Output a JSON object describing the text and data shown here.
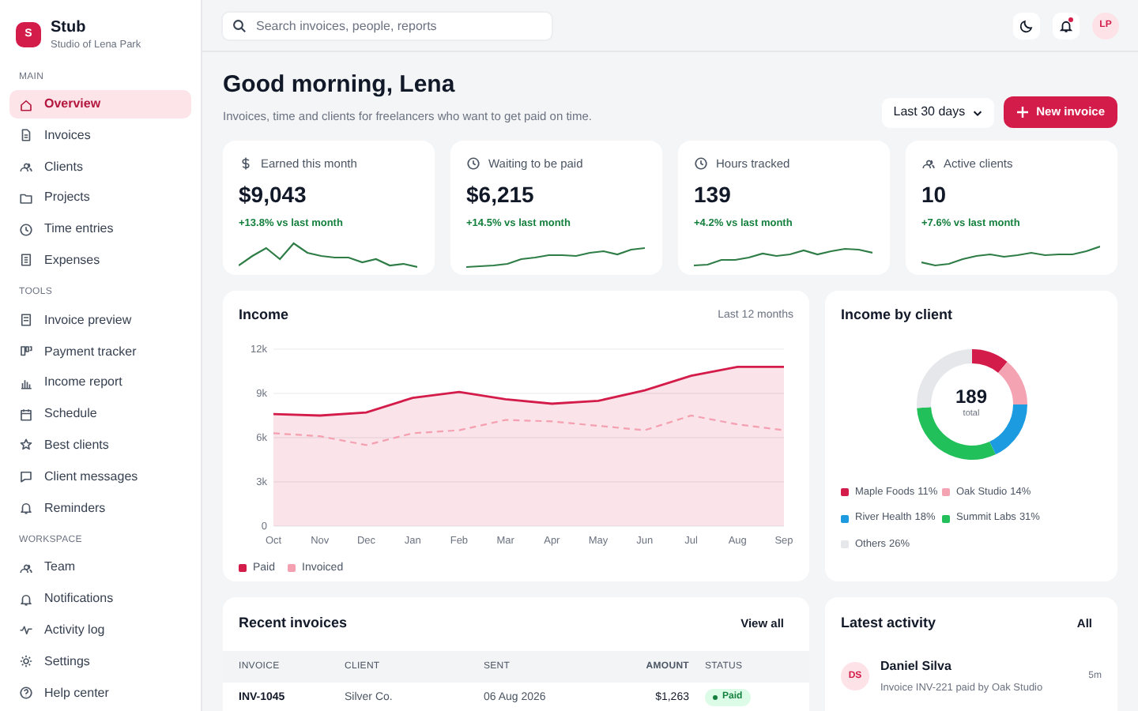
{
  "brand": {
    "logo": "S",
    "name": "Stub",
    "subtitle": "Studio of Lena Park"
  },
  "sidebar": {
    "sections": [
      {
        "title": "MAIN",
        "items": [
          {
            "label": "Overview",
            "selected": true
          },
          {
            "label": "Invoices",
            "selected": false
          },
          {
            "label": "Clients",
            "selected": false
          },
          {
            "label": "Projects",
            "selected": false
          },
          {
            "label": "Time entries",
            "selected": false
          },
          {
            "label": "Expenses",
            "selected": false
          }
        ]
      },
      {
        "title": "TOOLS",
        "items": [
          {
            "label": "Invoice preview",
            "selected": false
          },
          {
            "label": "Payment tracker",
            "selected": false
          },
          {
            "label": "Income report",
            "selected": false
          },
          {
            "label": "Schedule",
            "selected": false
          },
          {
            "label": "Best clients",
            "selected": false
          },
          {
            "label": "Client messages",
            "selected": false
          },
          {
            "label": "Reminders",
            "selected": false
          }
        ]
      },
      {
        "title": "WORKSPACE",
        "items": [
          {
            "label": "Team",
            "selected": false
          },
          {
            "label": "Notifications",
            "selected": false
          },
          {
            "label": "Activity log",
            "selected": false
          },
          {
            "label": "Settings",
            "selected": false
          },
          {
            "label": "Help center",
            "selected": false
          }
        ]
      }
    ]
  },
  "topbar": {
    "search": {
      "placeholder": "Search invoices, people, reports"
    },
    "notification_unread": true,
    "avatar": "LP"
  },
  "heading": {
    "title": "Good morning, Lena",
    "subtitle": "Invoices, time and clients for freelancers who want to get paid on time.",
    "range": "Last 30 days",
    "action": "New invoice"
  },
  "kpis": [
    {
      "label": "Earned this month",
      "value": "$9,043",
      "change": "+13.8% vs last month"
    },
    {
      "label": "Waiting to be paid",
      "value": "$6,215",
      "change": "+14.5% vs last month"
    },
    {
      "label": "Hours tracked",
      "value": "139",
      "change": "+4.2% vs last month"
    },
    {
      "label": "Active clients",
      "value": "10",
      "change": "+7.6% vs last month"
    }
  ],
  "income": {
    "title": "Income",
    "period": "Last 12 months",
    "chart_data": {
      "type": "area",
      "categories": [
        "Oct",
        "Nov",
        "Dec",
        "Jan",
        "Feb",
        "Mar",
        "Apr",
        "May",
        "Jun",
        "Jul",
        "Aug",
        "Sep"
      ],
      "ylim": [
        0,
        12000
      ],
      "grid": true,
      "yticks": [
        {
          "value": 0,
          "label": "0"
        },
        {
          "value": 3000,
          "label": "3k"
        },
        {
          "value": 6000,
          "label": "6k"
        },
        {
          "value": 9000,
          "label": "9k"
        },
        {
          "value": 12000,
          "label": "12k"
        }
      ],
      "series": [
        {
          "name": "Paid",
          "type": "area",
          "line_style": "solid",
          "color": "#d41c4a",
          "values": [
            7600,
            7500,
            7700,
            8700,
            9100,
            8600,
            8300,
            8500,
            9200,
            10200,
            10800,
            10800
          ]
        },
        {
          "name": "Invoiced",
          "type": "line",
          "line_style": "dashed",
          "color": "#f4a0b0",
          "values": [
            6300,
            6100,
            5500,
            6300,
            6500,
            7200,
            7100,
            6800,
            6500,
            7500,
            6900,
            6500
          ]
        }
      ]
    }
  },
  "by_client": {
    "title": "Income by client",
    "total": "189",
    "total_label": "total",
    "chart_data": {
      "type": "donut",
      "categories": [
        "Maple Foods",
        "Oak Studio",
        "River Health",
        "Summit Labs",
        "Others"
      ],
      "values": [
        11,
        14,
        18,
        31,
        26
      ],
      "value_labels": [
        "11%",
        "14%",
        "18%",
        "31%",
        "26%"
      ],
      "colors": [
        "#d41c4a",
        "#f4a3b3",
        "#1c9be0",
        "#22c05a",
        "#e5e7eb"
      ]
    }
  },
  "recent_invoices": {
    "title": "Recent invoices",
    "action": "View all",
    "columns": [
      "INVOICE",
      "CLIENT",
      "SENT",
      "AMOUNT",
      "STATUS"
    ],
    "rows": [
      {
        "invoice": "INV-1045",
        "client": "Silver Co.",
        "sent": "06 Aug 2026",
        "amount": "$1,263",
        "status": "Paid"
      }
    ]
  },
  "activity": {
    "title": "Latest activity",
    "action": "All",
    "items": [
      {
        "initials": "DS",
        "name": "Daniel Silva",
        "text": "Invoice INV-221 paid by Oak Studio",
        "time": "5m"
      }
    ]
  }
}
